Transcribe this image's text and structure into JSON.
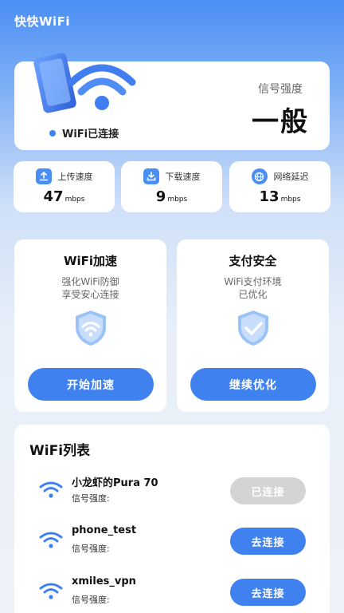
{
  "app": {
    "title": "快快WiFi"
  },
  "status": {
    "connection_text": "WiFi已连接",
    "signal_label": "信号强度",
    "signal_value": "一般"
  },
  "speeds": [
    {
      "label": "上传速度",
      "value": "47",
      "unit": "mbps",
      "icon": "upload-icon"
    },
    {
      "label": "下载速度",
      "value": "9",
      "unit": "mbps",
      "icon": "download-icon"
    },
    {
      "label": "网络延迟",
      "value": "13",
      "unit": "mbps",
      "icon": "globe-icon"
    }
  ],
  "features": [
    {
      "title": "WiFi加速",
      "desc_line1": "强化WiFi防御",
      "desc_line2": "享受安心连接",
      "button": "开始加速",
      "icon": "wifi-shield-icon"
    },
    {
      "title": "支付安全",
      "desc_line1": "WiFi支付环境",
      "desc_line2": "已优化",
      "button": "继续优化",
      "icon": "check-shield-icon"
    }
  ],
  "wifi_list": {
    "title": "WiFi列表",
    "networks": [
      {
        "name": "小龙虾的Pura 70",
        "signal_label": "信号强度:",
        "action": "已连接",
        "connected": true
      },
      {
        "name": "phone_test",
        "signal_label": "信号强度:",
        "action": "去连接",
        "connected": false
      },
      {
        "name": "xmiles_vpn",
        "signal_label": "信号强度:",
        "action": "去连接",
        "connected": false
      }
    ]
  },
  "colors": {
    "accent": "#3f82ef",
    "connected_button": "#d4d4d6",
    "header_blue": "#4a8ef5"
  }
}
